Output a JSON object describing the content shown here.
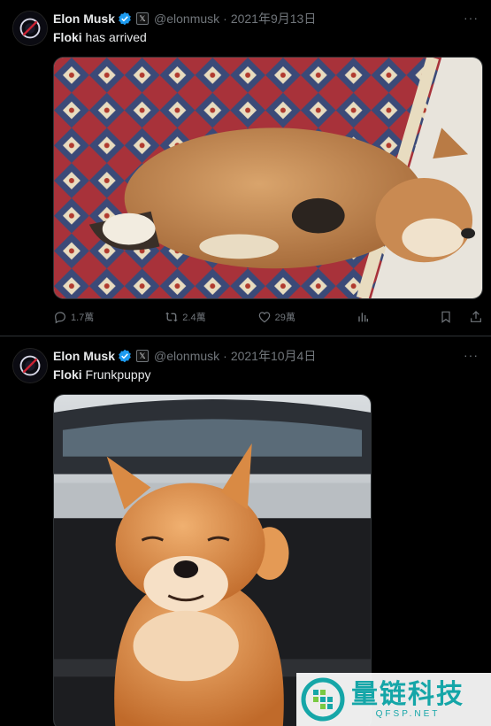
{
  "tweets": [
    {
      "author_name": "Elon Musk",
      "affiliation_badge": "𝕏",
      "handle": "@elonmusk",
      "separator": "·",
      "date": "2021年9月13日",
      "more": "···",
      "text_bold": "Floki",
      "text_rest": " has arrived",
      "replies": "1.7萬",
      "reposts": "2.4萬",
      "likes": "29萬",
      "media_icon": "sleeping-shiba-puppy-photo"
    },
    {
      "author_name": "Elon Musk",
      "affiliation_badge": "𝕏",
      "handle": "@elonmusk",
      "separator": "·",
      "date": "2021年10月4日",
      "more": "···",
      "text_bold": "Floki",
      "text_rest": " Frunkpuppy",
      "media_icon": "shiba-puppy-in-frunk-photo"
    }
  ],
  "watermark": {
    "main": "量链科技",
    "sub": "QFSP.NET"
  },
  "colors": {
    "background": "#000000",
    "text": "#e7e9ea",
    "muted": "#71767b",
    "verified": "#1d9bf0",
    "watermark": "#15a6a8"
  }
}
